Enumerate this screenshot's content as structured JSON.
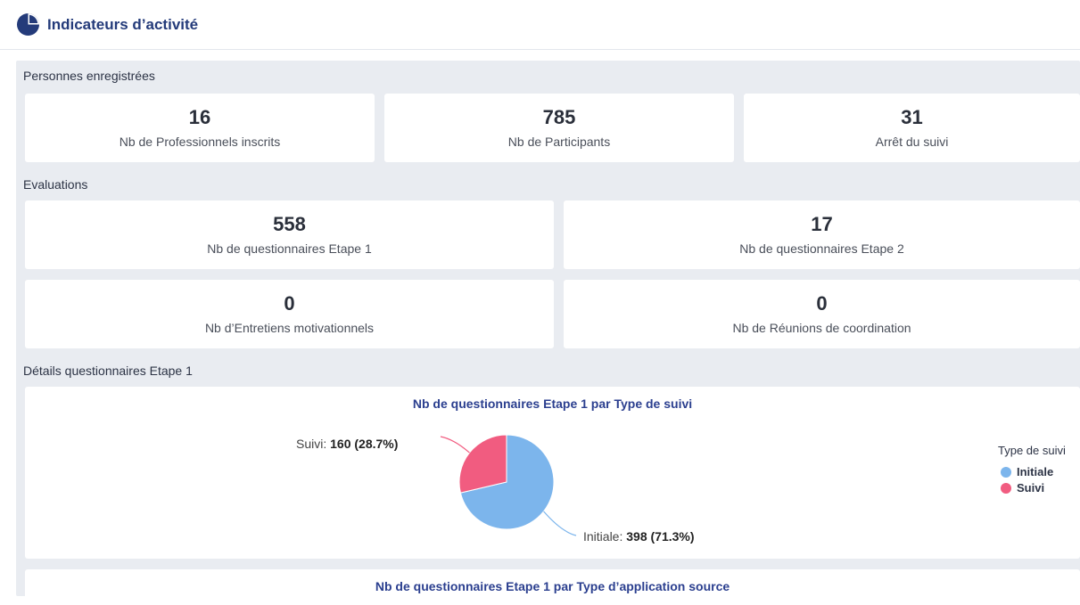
{
  "header": {
    "title": "Indicateurs d’activité",
    "icon": "pie-chart-icon"
  },
  "sections": {
    "registered": "Personnes enregistrées",
    "evaluations": "Evaluations",
    "details": "Détails questionnaires Etape 1"
  },
  "registered_cards": [
    {
      "value": "16",
      "label": "Nb de Professionnels inscrits"
    },
    {
      "value": "785",
      "label": "Nb de Participants"
    },
    {
      "value": "31",
      "label": "Arrêt du suivi"
    }
  ],
  "evaluation_cards": [
    {
      "value": "558",
      "label": "Nb de questionnaires Etape 1"
    },
    {
      "value": "17",
      "label": "Nb de questionnaires Etape 2"
    },
    {
      "value": "0",
      "label": "Nb d’Entretiens motivationnels"
    },
    {
      "value": "0",
      "label": "Nb de Réunions de coordination"
    }
  ],
  "colors": {
    "initiale": "#7cb5ec",
    "suivi": "#f15c80",
    "accent": "#243b7a"
  },
  "chart_data": {
    "type": "pie",
    "title": "Nb de questionnaires Etape 1 par Type de suivi",
    "legend_title": "Type de suivi",
    "legend_position": "right",
    "slices": [
      {
        "label": "Initiale",
        "value": 398,
        "percent": "71.3%"
      },
      {
        "label": "Suivi",
        "value": 160,
        "percent": "28.7%"
      }
    ],
    "data_labels": {
      "initiale_name": "Initiale:",
      "initiale_value": "398 (71.3%)",
      "suivi_name": "Suivi:",
      "suivi_value": "160 (28.7%)"
    }
  },
  "second_chart": {
    "title": "Nb de questionnaires Etape 1 par Type d’application source"
  }
}
